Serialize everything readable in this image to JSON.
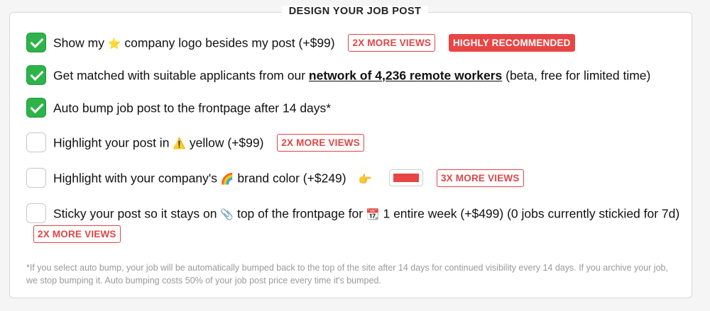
{
  "section_title": "DESIGN YOUR JOB POST",
  "options": {
    "logo": {
      "text_before": "Show my",
      "icon": "⭐",
      "text_after": "company logo besides my post (+$99)",
      "badge": "2X MORE VIEWS",
      "badge2": "HIGHLY RECOMMENDED",
      "checked": true
    },
    "match": {
      "text_before": "Get matched with suitable applicants from our",
      "link": "network of 4,236 remote workers",
      "text_after": "(beta, free for limited time)",
      "checked": true
    },
    "bump": {
      "text": "Auto bump job post to the frontpage after 14 days*",
      "checked": true
    },
    "yellow": {
      "text_before": "Highlight your post in",
      "icon": "⚠️",
      "text_after": "yellow (+$99)",
      "badge": "2X MORE VIEWS",
      "checked": false
    },
    "brand": {
      "text_before": "Highlight with your company's",
      "icon": "🌈",
      "text_after": "brand color (+$249)",
      "pointer": "👉",
      "swatch_color": "#e84545",
      "badge": "3X MORE VIEWS",
      "checked": false
    },
    "sticky": {
      "text_before": "Sticky your post so it stays on",
      "icon1": "📎",
      "text_mid": "top of the frontpage for",
      "icon2": "📆",
      "text_after": "1 entire week (+$499) (0 jobs currently stickied for 7d)",
      "badge": "2X MORE VIEWS",
      "checked": false
    }
  },
  "footnote": "*If you select auto bump, your job will be automatically bumped back to the top of the site after 14 days for continued visibility every 14 days. If you archive your job, we stop bumping it. Auto bumping costs 50% of your job post price every time it's bumped."
}
